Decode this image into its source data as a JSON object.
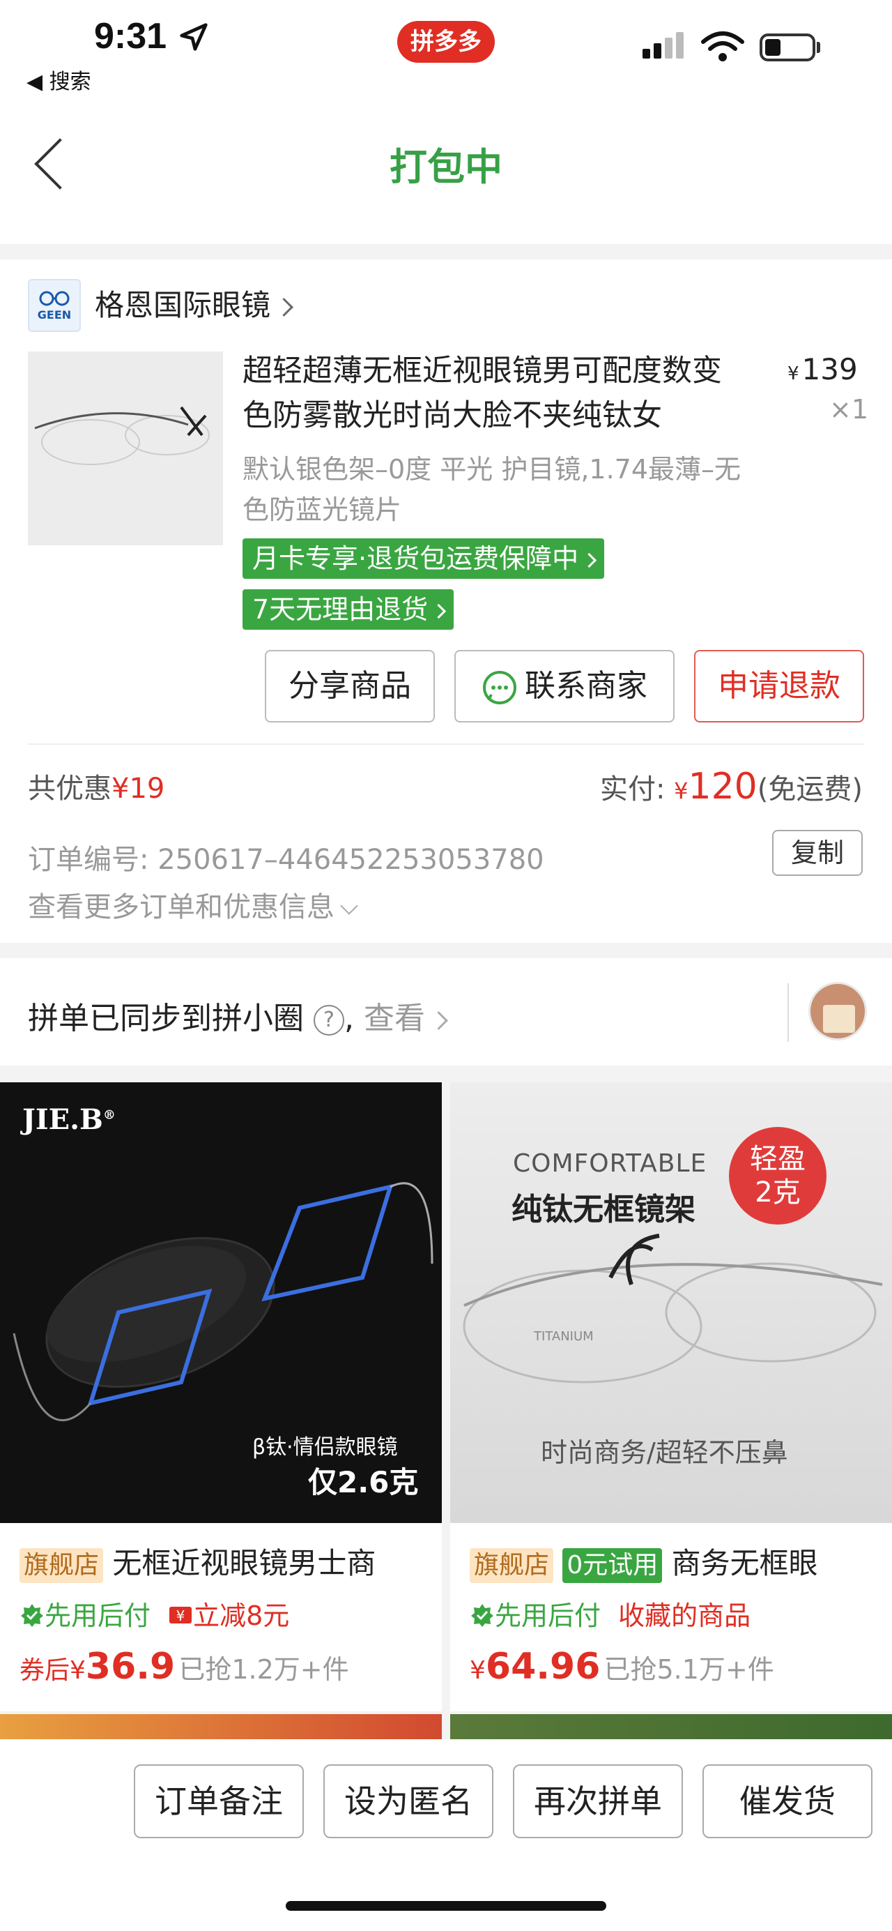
{
  "status_bar": {
    "time": "9:31",
    "back_label": "◀ 搜索",
    "app_badge": "拼多多"
  },
  "nav": {
    "title": "打包中"
  },
  "shop": {
    "logo_text": "GEEN",
    "name": "格恩国际眼镜"
  },
  "product": {
    "title": "超轻超薄无框近视眼镜男可配度数变色防雾散光时尚大脸不夹纯钛女",
    "price_symbol": "¥",
    "price": "139",
    "quantity": "×1",
    "spec": "默认银色架–0度 平光 护目镜,1.74最薄–无色防蓝光镜片",
    "tags": [
      "月卡专享·退货包运费保障中",
      "7天无理由退货"
    ]
  },
  "actions": {
    "share": "分享商品",
    "contact": "联系商家",
    "refund": "申请退款"
  },
  "summary": {
    "discount_label": "共优惠",
    "discount_value": "¥19",
    "paid_label": "实付:",
    "paid_symbol": "¥",
    "paid_amount": "120",
    "shipping": "(免运费)",
    "order_no": "订单编号:  250617–446452253053780",
    "copy": "复制",
    "more": "查看更多订单和优惠信息"
  },
  "sync": {
    "text": "拼单已同步到拼小圈",
    "help": "?",
    "sep": ",",
    "view": "查看"
  },
  "recommendations": [
    {
      "image": {
        "brand": "JIE.B",
        "reg": "®",
        "caption1": "β钛·情侣款眼镜",
        "caption2": "仅2.6克"
      },
      "badges": [
        "旗舰店"
      ],
      "title": "无框近视眼镜男士商",
      "features": [
        "先用后付",
        "立减8元"
      ],
      "price_prefix": "券后",
      "price_symbol": "¥",
      "price": "36.9",
      "sold": "已抢1.2万+件"
    },
    {
      "image": {
        "line1": "COMFORTABLE",
        "line2": "纯钛无框镜架",
        "bubble1": "轻盈",
        "bubble2": "2克",
        "caption": "时尚商务/超轻不压鼻",
        "lens_text": "TITANIUM"
      },
      "badges": [
        "旗舰店",
        "0元试用"
      ],
      "title": "商务无框眼",
      "features": [
        "先用后付",
        "收藏的商品"
      ],
      "price_prefix": "",
      "price_symbol": "¥",
      "price": "64.96",
      "sold": "已抢5.1万+件"
    }
  ],
  "bottom_bar": [
    "订单备注",
    "设为匿名",
    "再次拼单",
    "催发货"
  ],
  "colors": {
    "accent_green": "#37a046",
    "price_red": "#e02e24",
    "tag_green": "#3aa641"
  }
}
